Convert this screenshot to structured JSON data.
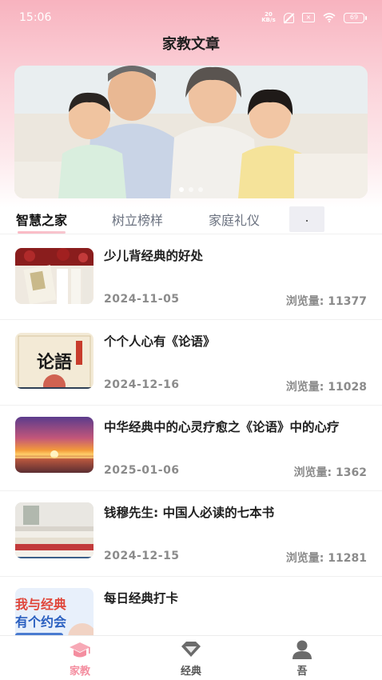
{
  "status_bar": {
    "time": "15:06",
    "network": "20KB/s",
    "sim_label": "×",
    "battery": "69"
  },
  "header": {
    "title": "家教文章"
  },
  "banner": {
    "slides": 3,
    "active_slide": 0
  },
  "tabs": [
    {
      "label": "智慧之家",
      "active": true
    },
    {
      "label": "树立榜样",
      "active": false
    },
    {
      "label": "家庭礼仪",
      "active": false
    },
    {
      "label": ".",
      "active": false
    }
  ],
  "articles": [
    {
      "title": "少儿背经典的好处",
      "date": "2024-11-05",
      "views": "浏览量: 11377"
    },
    {
      "title": "个个人心有《论语》",
      "date": "2024-12-16",
      "views": "浏览量: 11028"
    },
    {
      "title": "中华经典中的心灵疗愈之《论语》中的心疗",
      "date": "2025-01-06",
      "views": "浏览量: 1362"
    },
    {
      "title": "钱穆先生: 中国人必读的七本书",
      "date": "2024-12-15",
      "views": "浏览量: 11281"
    },
    {
      "title": "每日经典打卡",
      "date": "",
      "views": ""
    }
  ],
  "thumb_text": {
    "lunyu": "论語",
    "promo_line1": "我与经典",
    "promo_line2": "有个约会"
  },
  "bottom_nav": [
    {
      "label": "家教",
      "icon": "graduation-cap-icon",
      "active": true
    },
    {
      "label": "经典",
      "icon": "diamond-icon",
      "active": false
    },
    {
      "label": "吾",
      "icon": "user-icon",
      "active": false
    }
  ],
  "colors": {
    "accent": "#f48ea0",
    "header_gradient": "#f8b3bf"
  }
}
